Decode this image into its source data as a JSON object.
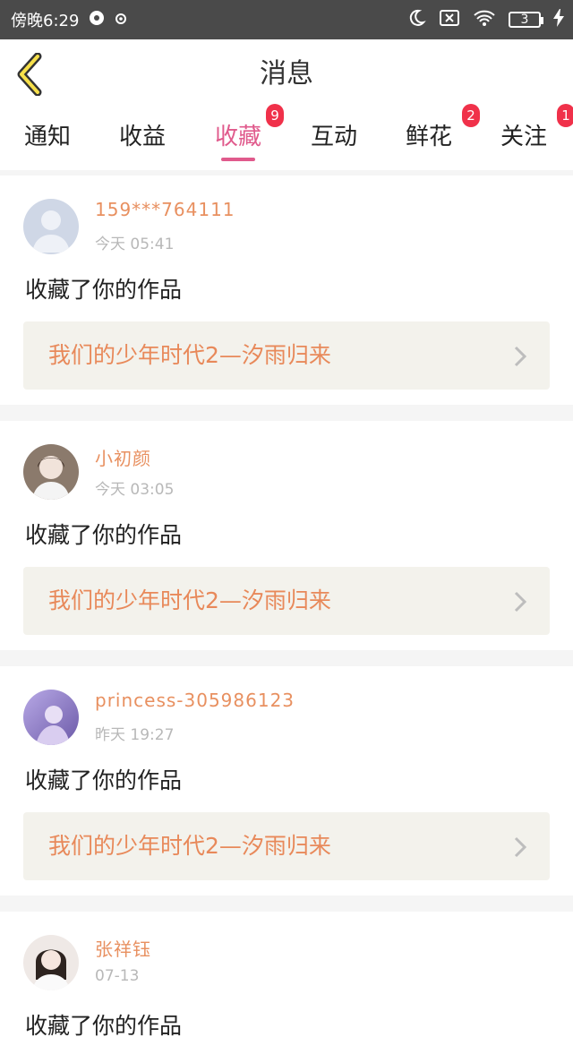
{
  "status_bar": {
    "time": "傍晚6:29",
    "battery": "3"
  },
  "header": {
    "title": "消息"
  },
  "tabs": [
    {
      "label": "通知",
      "badge": ""
    },
    {
      "label": "收益",
      "badge": ""
    },
    {
      "label": "收藏",
      "badge": "9",
      "active": true
    },
    {
      "label": "互动",
      "badge": ""
    },
    {
      "label": "鲜花",
      "badge": "2"
    },
    {
      "label": "关注",
      "badge": "1"
    }
  ],
  "messages": [
    {
      "user": "159***764111",
      "time": "今天 05:41",
      "action": "收藏了你的作品",
      "work": "我们的少年时代2—汐雨归来"
    },
    {
      "user": "小初颜",
      "time": "今天 03:05",
      "action": "收藏了你的作品",
      "work": "我们的少年时代2—汐雨归来"
    },
    {
      "user": "princess-305986123",
      "time": "昨天 19:27",
      "action": "收藏了你的作品",
      "work": "我们的少年时代2—汐雨归来"
    },
    {
      "user": "张祥钰",
      "time": "07-13",
      "action": "收藏了你的作品",
      "work": ""
    }
  ],
  "colors": {
    "accent": "#e05a8c",
    "username": "#e89060",
    "work_title": "#e8895a",
    "badge": "#f0314a"
  }
}
